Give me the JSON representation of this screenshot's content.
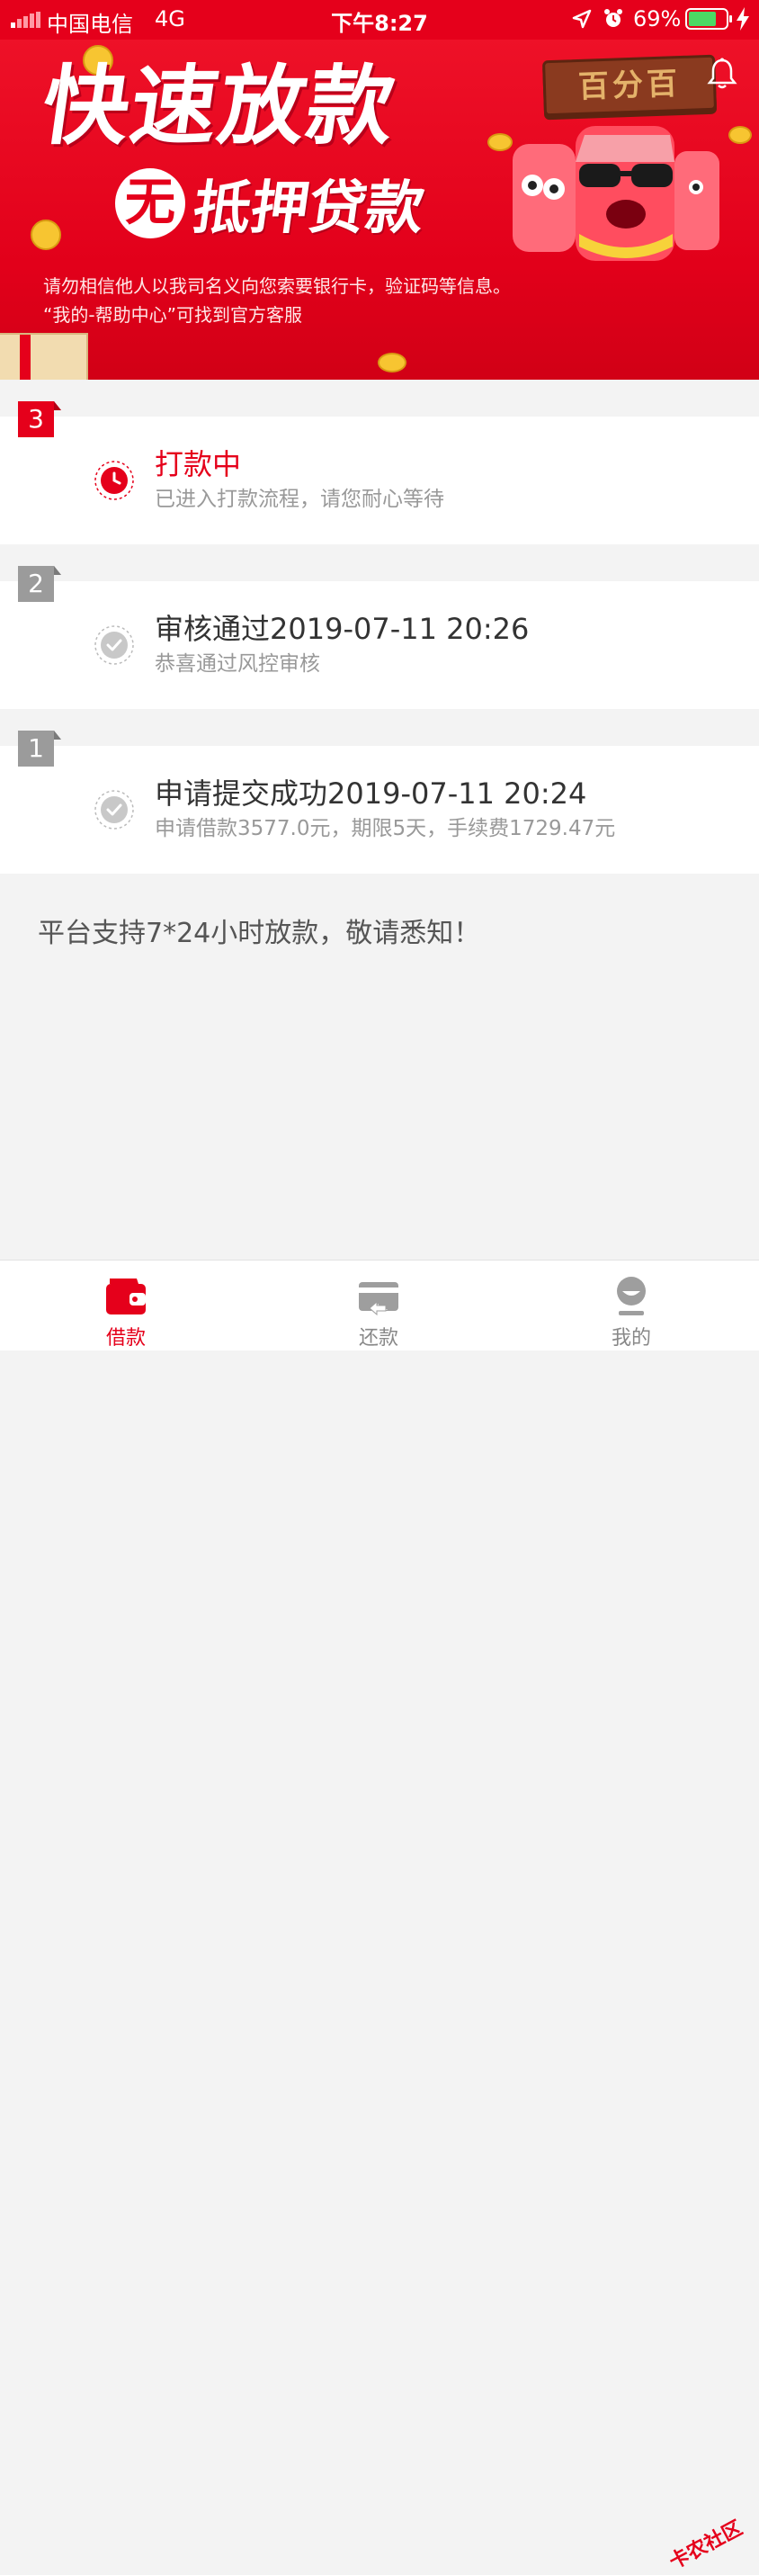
{
  "status_bar": {
    "carrier": "中国电信",
    "network": "4G",
    "time": "下午8:27",
    "battery": "69%"
  },
  "banner": {
    "title": "快速放款",
    "subtitle_prefix": "无",
    "subtitle": "抵押贷款",
    "brand_sign": "百分百",
    "notice_line1": "请勿相信他人以我司名义向您索要银行卡，验证码等信息。",
    "notice_line2": "“我的-帮助中心”可找到官方客服"
  },
  "steps": [
    {
      "number": "3",
      "title": "打款中",
      "description": "已进入打款流程，请您耐心等待",
      "status": "in-progress"
    },
    {
      "number": "2",
      "title": "审核通过2019-07-11 20:26",
      "description": "恭喜通过风控审核",
      "status": "done"
    },
    {
      "number": "1",
      "title": "申请提交成功2019-07-11 20:24",
      "description": "申请借款3577.0元，期限5天，手续费1729.47元",
      "status": "done"
    }
  ],
  "notice": "平台支持7*24小时放款，敬请悉知！",
  "tabs": [
    {
      "label": "借款",
      "icon": "wallet-icon",
      "active": true
    },
    {
      "label": "还款",
      "icon": "repay-card-icon",
      "active": false
    },
    {
      "label": "我的",
      "icon": "profile-icon",
      "active": false
    }
  ],
  "watermark": "卡农社区",
  "colors": {
    "accent": "#e5001b",
    "inactive_badge": "#9b9b9b",
    "text": "#333333",
    "muted": "#999999"
  }
}
